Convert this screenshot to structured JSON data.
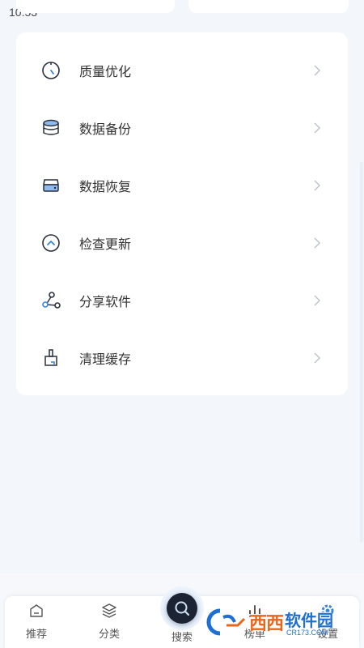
{
  "status_bar": {
    "time": "10:53"
  },
  "menu": {
    "items": [
      {
        "label": "质量优化",
        "icon": "timer-icon"
      },
      {
        "label": "数据备份",
        "icon": "database-icon"
      },
      {
        "label": "数据恢复",
        "icon": "drive-icon"
      },
      {
        "label": "检查更新",
        "icon": "arrow-up-circle-icon"
      },
      {
        "label": "分享软件",
        "icon": "share-icon"
      },
      {
        "label": "清理缓存",
        "icon": "broom-icon"
      }
    ]
  },
  "bottom_nav": {
    "items": [
      {
        "label": "推荐",
        "icon": "home-icon"
      },
      {
        "label": "分类",
        "icon": "layers-icon"
      },
      {
        "label": "搜索",
        "icon": "search-icon"
      },
      {
        "label": "榜单",
        "icon": "chart-icon"
      },
      {
        "label": "设置",
        "icon": "gear-icon"
      }
    ]
  },
  "watermark": {
    "text_orange": "西西",
    "text_blue": "软件园",
    "sub": "CR173.COM"
  },
  "colors": {
    "accent": "#3b82d6",
    "icon_dark": "#2a2f3a",
    "background": "#f3f7fc"
  }
}
